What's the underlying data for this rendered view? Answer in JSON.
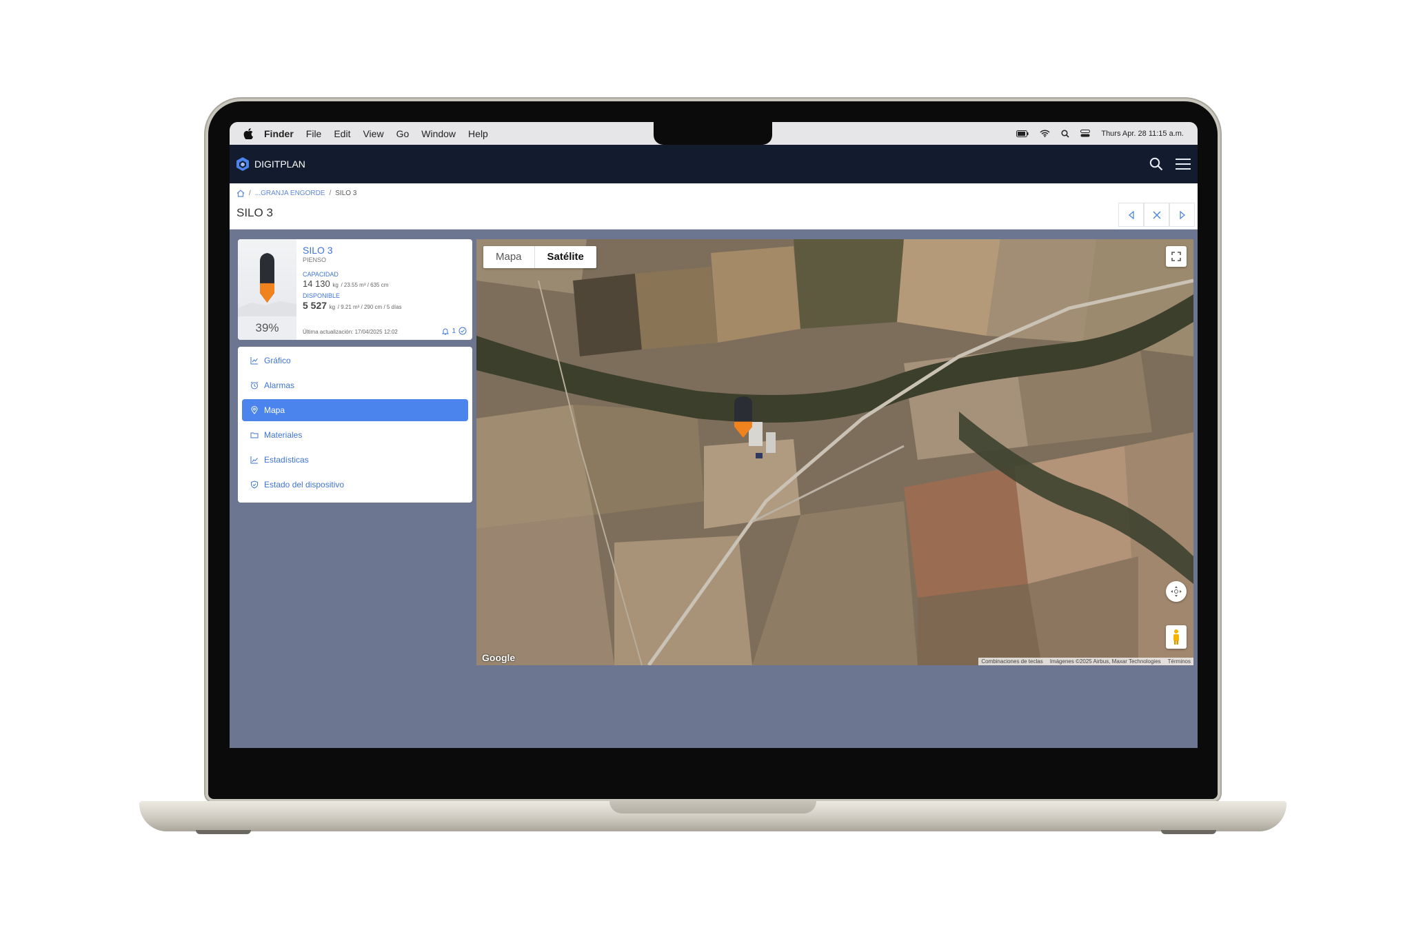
{
  "menubar": {
    "app": "Finder",
    "items": [
      "File",
      "Edit",
      "View",
      "Go",
      "Window",
      "Help"
    ],
    "clock": "Thurs Apr. 28 11:15 a.m."
  },
  "app": {
    "brand": "DIGITPLAN"
  },
  "breadcrumb": {
    "sep": "/",
    "parent": "...GRANJA ENGORDE",
    "current": "SILO 3"
  },
  "page": {
    "title": "SILO 3"
  },
  "silo": {
    "name": "SILO 3",
    "type": "PIENSO",
    "capacity_label": "CAPACIDAD",
    "capacity_value": "14 130",
    "capacity_unit": "kg",
    "capacity_detail": "/ 23.55 m³ / 635 cm",
    "available_label": "DISPONIBLE",
    "available_value": "5 527",
    "available_unit": "kg",
    "available_detail": "/ 9.21 m³ / 290 cm / 5 días",
    "percent": "39%",
    "fill_fraction": 0.39,
    "last_update": "Última actualización: 17/04/2025 12:02",
    "alarm_count": "1",
    "fill_color": "#f0831e",
    "empty_color": "#2a2d33"
  },
  "menu": {
    "items": [
      {
        "label": "Gráfico",
        "icon": "line-chart-icon"
      },
      {
        "label": "Alarmas",
        "icon": "alarm-clock-icon"
      },
      {
        "label": "Mapa",
        "icon": "map-pin-icon",
        "active": true
      },
      {
        "label": "Materiales",
        "icon": "folder-icon"
      },
      {
        "label": "Estadísticas",
        "icon": "stats-chart-icon"
      },
      {
        "label": "Estado del dispositivo",
        "icon": "shield-icon"
      }
    ]
  },
  "map": {
    "tabs": [
      "Mapa",
      "Satélite"
    ],
    "active_tab": "Satélite",
    "google": "Google",
    "attribution": [
      "Combinaciones de teclas",
      "Imágenes ©2025 Airbus, Maxar Technologies",
      "Términos"
    ]
  },
  "colors": {
    "accent": "#4b84ec",
    "header": "#131c2e",
    "content_bg": "#6c7690"
  }
}
